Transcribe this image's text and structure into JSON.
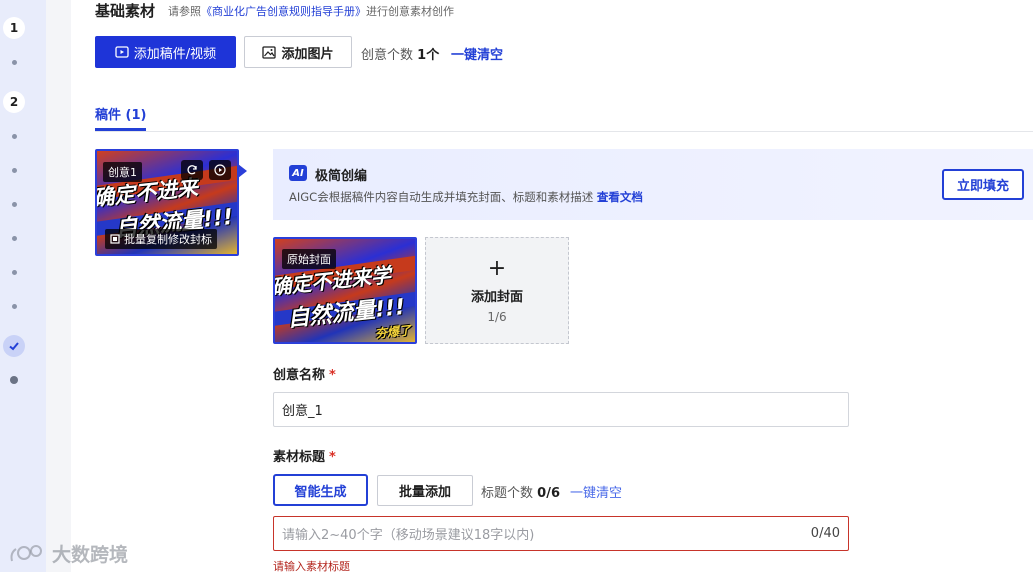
{
  "steps": [
    {
      "type": "number",
      "label": "1"
    },
    {
      "type": "dot"
    },
    {
      "type": "number",
      "label": "2"
    },
    {
      "type": "dot"
    },
    {
      "type": "dot"
    },
    {
      "type": "dot"
    },
    {
      "type": "dot"
    },
    {
      "type": "dot"
    },
    {
      "type": "dot"
    },
    {
      "type": "check",
      "icon": "check-icon"
    },
    {
      "type": "dot-big"
    }
  ],
  "section": {
    "title": "基础素材",
    "subtitle_prefix": "请参照",
    "subtitle_link": "《商业化广告创意规则指导手册》",
    "subtitle_suffix": "进行创意素材创作"
  },
  "toolbar": {
    "add_video_label": "添加稿件/视频",
    "add_image_label": "添加图片",
    "count_label": "创意个数",
    "count_value": "1个",
    "clear_label": "一键清空"
  },
  "tabs": [
    {
      "label": "稿件 (1)",
      "active": true
    }
  ],
  "creative_card": {
    "tag": "创意1",
    "line1": "确定不进来",
    "line2": "自然流量!!!",
    "batch_label": "批量复制修改封标",
    "icons": [
      "refresh-icon",
      "play-icon",
      "copy-icon"
    ]
  },
  "ai_banner": {
    "badge": "AI",
    "title": "极简创编",
    "desc": "AIGC会根据稿件内容自动生成并填充封面、标题和素材描述",
    "doc_link": "查看文档",
    "fill_button": "立即填充"
  },
  "covers": {
    "original_tag": "原始封面",
    "line1": "确定不进来学",
    "line2": "自然流量!!!",
    "line3": "夯爆了",
    "add_label": "添加封面",
    "add_count": "1/6"
  },
  "form": {
    "name_label": "创意名称",
    "name_value": "创意_1",
    "title_label": "素材标题",
    "smart_gen_label": "智能生成",
    "batch_add_label": "批量添加",
    "title_count_label": "标题个数",
    "title_count_value": "0/6",
    "title_clear_label": "一键清空",
    "title_placeholder": "请输入2~40个字（移动场景建议18字以内)",
    "title_counter": "0/40",
    "error_message": "请输入素材标题",
    "required_mark": "*"
  },
  "watermark": {
    "text": "大数跨境"
  },
  "colors": {
    "primary": "#1e34d8",
    "link": "#2340d6",
    "error": "#c7342a",
    "rail": "#e8ecfb"
  }
}
